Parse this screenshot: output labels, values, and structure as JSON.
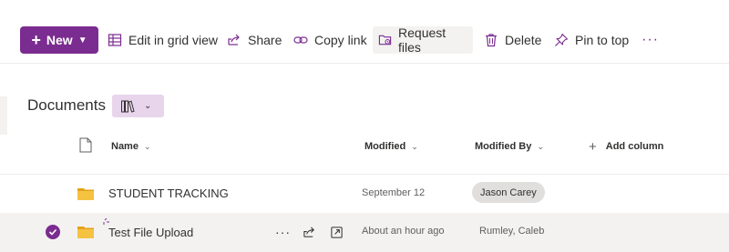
{
  "toolbar": {
    "new_label": "New",
    "edit_grid_label": "Edit in grid view",
    "share_label": "Share",
    "copy_link_label": "Copy link",
    "request_files_label": "Request files",
    "delete_label": "Delete",
    "pin_label": "Pin to top",
    "more_label": "···"
  },
  "library": {
    "title": "Documents"
  },
  "columns": {
    "name": "Name",
    "modified": "Modified",
    "modified_by": "Modified By",
    "add_column": "Add column"
  },
  "rows": [
    {
      "name": "STUDENT TRACKING",
      "modified": "September 12",
      "modified_by": "Jason Carey",
      "selected": false
    },
    {
      "name": "Test File Upload",
      "modified": "About an hour ago",
      "modified_by": "Rumley, Caleb",
      "selected": true,
      "more": "···"
    }
  ],
  "colors": {
    "accent": "#7b2c90",
    "folder": "#f5c242",
    "selected_row": "#f3f2f1",
    "view_switch_bg": "#e8d5ec"
  }
}
